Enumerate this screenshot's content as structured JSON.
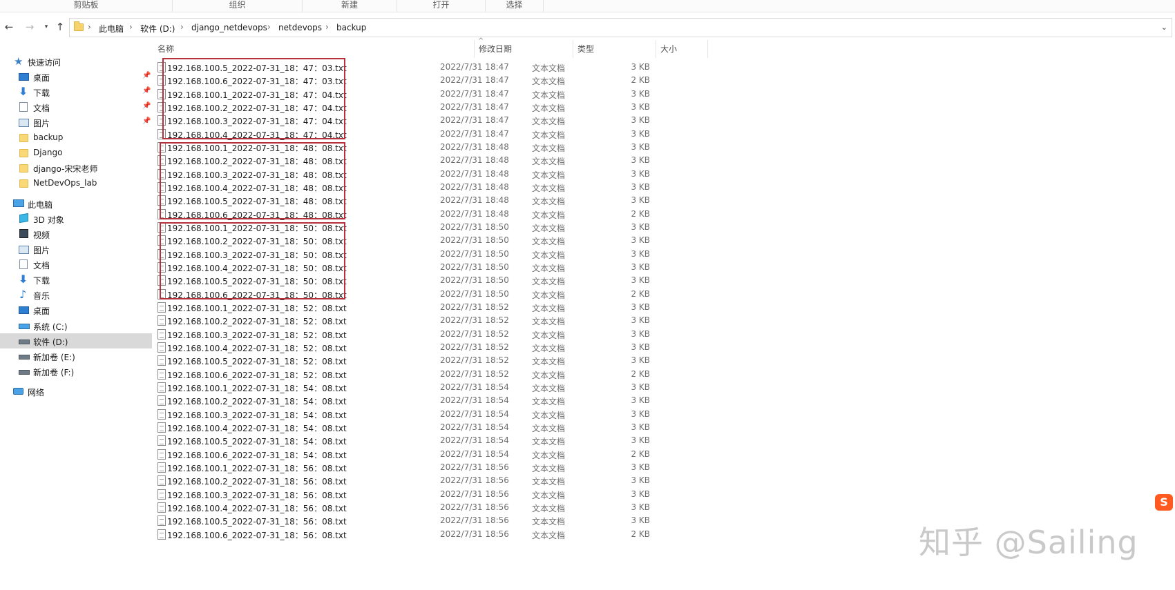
{
  "ribbon": {
    "groups": [
      "剪贴板",
      "组织",
      "新建",
      "打开",
      "选择"
    ]
  },
  "address": {
    "crumbs": [
      "此电脑",
      "软件 (D:)",
      "django_netdevops",
      "netdevops",
      "backup"
    ]
  },
  "nav": {
    "quick_access": "快速访问",
    "pinned": [
      "桌面",
      "下载",
      "文档",
      "图片"
    ],
    "folders": [
      "backup",
      "Django",
      "django-宋宋老师",
      "NetDevOps_lab"
    ],
    "this_pc": "此电脑",
    "pc_items": [
      "3D 对象",
      "视频",
      "图片",
      "文档",
      "下载",
      "音乐",
      "桌面"
    ],
    "drives": [
      "系统 (C:)",
      "软件 (D:)",
      "新加卷 (E:)",
      "新加卷 (F:)"
    ],
    "network": "网络"
  },
  "columns": {
    "name": "名称",
    "date": "修改日期",
    "type": "类型",
    "size": "大小"
  },
  "files": [
    {
      "name": "192.168.100.5_2022-07-31_18：47：03.txt",
      "date": "2022/7/31 18:47",
      "type": "文本文档",
      "size": "3 KB"
    },
    {
      "name": "192.168.100.6_2022-07-31_18：47：03.txt",
      "date": "2022/7/31 18:47",
      "type": "文本文档",
      "size": "2 KB"
    },
    {
      "name": "192.168.100.1_2022-07-31_18：47：04.txt",
      "date": "2022/7/31 18:47",
      "type": "文本文档",
      "size": "3 KB"
    },
    {
      "name": "192.168.100.2_2022-07-31_18：47：04.txt",
      "date": "2022/7/31 18:47",
      "type": "文本文档",
      "size": "3 KB"
    },
    {
      "name": "192.168.100.3_2022-07-31_18：47：04.txt",
      "date": "2022/7/31 18:47",
      "type": "文本文档",
      "size": "3 KB"
    },
    {
      "name": "192.168.100.4_2022-07-31_18：47：04.txt",
      "date": "2022/7/31 18:47",
      "type": "文本文档",
      "size": "3 KB"
    },
    {
      "name": "192.168.100.1_2022-07-31_18：48：08.txt",
      "date": "2022/7/31 18:48",
      "type": "文本文档",
      "size": "3 KB"
    },
    {
      "name": "192.168.100.2_2022-07-31_18：48：08.txt",
      "date": "2022/7/31 18:48",
      "type": "文本文档",
      "size": "3 KB"
    },
    {
      "name": "192.168.100.3_2022-07-31_18：48：08.txt",
      "date": "2022/7/31 18:48",
      "type": "文本文档",
      "size": "3 KB"
    },
    {
      "name": "192.168.100.4_2022-07-31_18：48：08.txt",
      "date": "2022/7/31 18:48",
      "type": "文本文档",
      "size": "3 KB"
    },
    {
      "name": "192.168.100.5_2022-07-31_18：48：08.txt",
      "date": "2022/7/31 18:48",
      "type": "文本文档",
      "size": "3 KB"
    },
    {
      "name": "192.168.100.6_2022-07-31_18：48：08.txt",
      "date": "2022/7/31 18:48",
      "type": "文本文档",
      "size": "2 KB"
    },
    {
      "name": "192.168.100.1_2022-07-31_18：50：08.txt",
      "date": "2022/7/31 18:50",
      "type": "文本文档",
      "size": "3 KB"
    },
    {
      "name": "192.168.100.2_2022-07-31_18：50：08.txt",
      "date": "2022/7/31 18:50",
      "type": "文本文档",
      "size": "3 KB"
    },
    {
      "name": "192.168.100.3_2022-07-31_18：50：08.txt",
      "date": "2022/7/31 18:50",
      "type": "文本文档",
      "size": "3 KB"
    },
    {
      "name": "192.168.100.4_2022-07-31_18：50：08.txt",
      "date": "2022/7/31 18:50",
      "type": "文本文档",
      "size": "3 KB"
    },
    {
      "name": "192.168.100.5_2022-07-31_18：50：08.txt",
      "date": "2022/7/31 18:50",
      "type": "文本文档",
      "size": "3 KB"
    },
    {
      "name": "192.168.100.6_2022-07-31_18：50：08.txt",
      "date": "2022/7/31 18:50",
      "type": "文本文档",
      "size": "2 KB"
    },
    {
      "name": "192.168.100.1_2022-07-31_18：52：08.txt",
      "date": "2022/7/31 18:52",
      "type": "文本文档",
      "size": "3 KB"
    },
    {
      "name": "192.168.100.2_2022-07-31_18：52：08.txt",
      "date": "2022/7/31 18:52",
      "type": "文本文档",
      "size": "3 KB"
    },
    {
      "name": "192.168.100.3_2022-07-31_18：52：08.txt",
      "date": "2022/7/31 18:52",
      "type": "文本文档",
      "size": "3 KB"
    },
    {
      "name": "192.168.100.4_2022-07-31_18：52：08.txt",
      "date": "2022/7/31 18:52",
      "type": "文本文档",
      "size": "3 KB"
    },
    {
      "name": "192.168.100.5_2022-07-31_18：52：08.txt",
      "date": "2022/7/31 18:52",
      "type": "文本文档",
      "size": "3 KB"
    },
    {
      "name": "192.168.100.6_2022-07-31_18：52：08.txt",
      "date": "2022/7/31 18:52",
      "type": "文本文档",
      "size": "2 KB"
    },
    {
      "name": "192.168.100.1_2022-07-31_18：54：08.txt",
      "date": "2022/7/31 18:54",
      "type": "文本文档",
      "size": "3 KB"
    },
    {
      "name": "192.168.100.2_2022-07-31_18：54：08.txt",
      "date": "2022/7/31 18:54",
      "type": "文本文档",
      "size": "3 KB"
    },
    {
      "name": "192.168.100.3_2022-07-31_18：54：08.txt",
      "date": "2022/7/31 18:54",
      "type": "文本文档",
      "size": "3 KB"
    },
    {
      "name": "192.168.100.4_2022-07-31_18：54：08.txt",
      "date": "2022/7/31 18:54",
      "type": "文本文档",
      "size": "3 KB"
    },
    {
      "name": "192.168.100.5_2022-07-31_18：54：08.txt",
      "date": "2022/7/31 18:54",
      "type": "文本文档",
      "size": "3 KB"
    },
    {
      "name": "192.168.100.6_2022-07-31_18：54：08.txt",
      "date": "2022/7/31 18:54",
      "type": "文本文档",
      "size": "2 KB"
    },
    {
      "name": "192.168.100.1_2022-07-31_18：56：08.txt",
      "date": "2022/7/31 18:56",
      "type": "文本文档",
      "size": "3 KB"
    },
    {
      "name": "192.168.100.2_2022-07-31_18：56：08.txt",
      "date": "2022/7/31 18:56",
      "type": "文本文档",
      "size": "3 KB"
    },
    {
      "name": "192.168.100.3_2022-07-31_18：56：08.txt",
      "date": "2022/7/31 18:56",
      "type": "文本文档",
      "size": "3 KB"
    },
    {
      "name": "192.168.100.4_2022-07-31_18：56：08.txt",
      "date": "2022/7/31 18:56",
      "type": "文本文档",
      "size": "3 KB"
    },
    {
      "name": "192.168.100.5_2022-07-31_18：56：08.txt",
      "date": "2022/7/31 18:56",
      "type": "文本文档",
      "size": "3 KB"
    },
    {
      "name": "192.168.100.6_2022-07-31_18：56：08.txt",
      "date": "2022/7/31 18:56",
      "type": "文本文档",
      "size": "2 KB"
    }
  ],
  "watermark": "知乎 @Sailing",
  "ime_badge": "S",
  "colors": {
    "highlight_border": "#b5303a",
    "selected_nav_bg": "#d9d9d9"
  }
}
